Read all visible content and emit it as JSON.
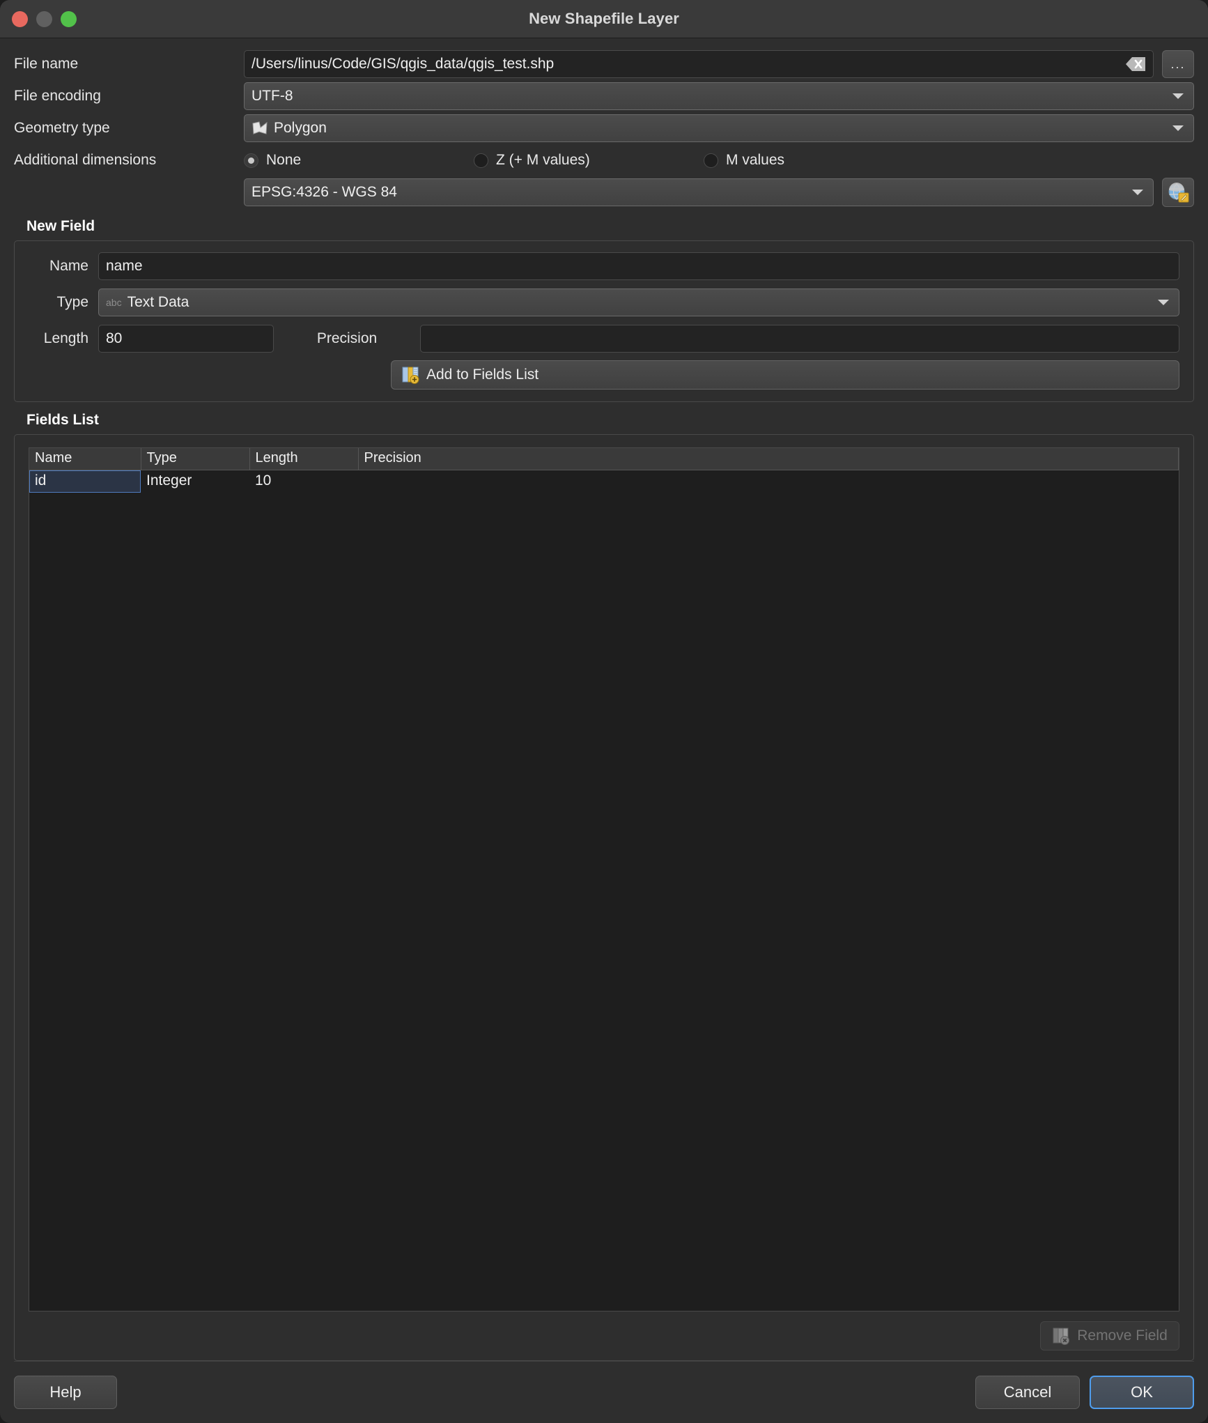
{
  "window": {
    "title": "New Shapefile Layer",
    "traffic_lights": [
      "close-button",
      "minimize-button",
      "maximize-button"
    ]
  },
  "form": {
    "file_name": {
      "label": "File name",
      "value": "/Users/linus/Code/GIS/qgis_data/qgis_test.shp",
      "placeholder": "",
      "clear_icon": "clear-icon",
      "browse_label": "..."
    },
    "file_encoding": {
      "label": "File encoding",
      "value": "UTF-8"
    },
    "geometry_type": {
      "label": "Geometry type",
      "value": "Polygon",
      "icon": "polygon-icon"
    },
    "additional_dimensions": {
      "label": "Additional dimensions",
      "options": [
        {
          "label": "None",
          "checked": true
        },
        {
          "label": "Z (+ M values)",
          "checked": false
        },
        {
          "label": "M values",
          "checked": false
        }
      ]
    },
    "crs": {
      "value": "EPSG:4326 - WGS 84",
      "select_icon": "crs-globe-icon"
    }
  },
  "new_field": {
    "title": "New Field",
    "name_label": "Name",
    "name_value": "name",
    "type_label": "Type",
    "type_value": "Text Data",
    "type_icon_text": "abc",
    "length_label": "Length",
    "length_value": "80",
    "precision_label": "Precision",
    "precision_value": "",
    "add_button": "Add to Fields List",
    "add_button_icon": "add-field-icon"
  },
  "fields_list": {
    "title": "Fields List",
    "columns": [
      "Name",
      "Type",
      "Length",
      "Precision"
    ],
    "rows": [
      {
        "name": "id",
        "type": "Integer",
        "length": "10",
        "precision": "",
        "selected": true
      }
    ],
    "remove_button": "Remove Field",
    "remove_button_icon": "remove-field-icon",
    "remove_button_enabled": false
  },
  "footer": {
    "help": "Help",
    "cancel": "Cancel",
    "ok": "OK"
  },
  "colors": {
    "window_bg": "#2e2e2e",
    "titlebar_bg": "#3a3a3a",
    "input_bg": "#232323",
    "accent_focus": "#4f9ded",
    "selection_bg": "#2b3445",
    "close": "#e8695f",
    "minimize": "#606060",
    "maximize": "#52c14a"
  }
}
